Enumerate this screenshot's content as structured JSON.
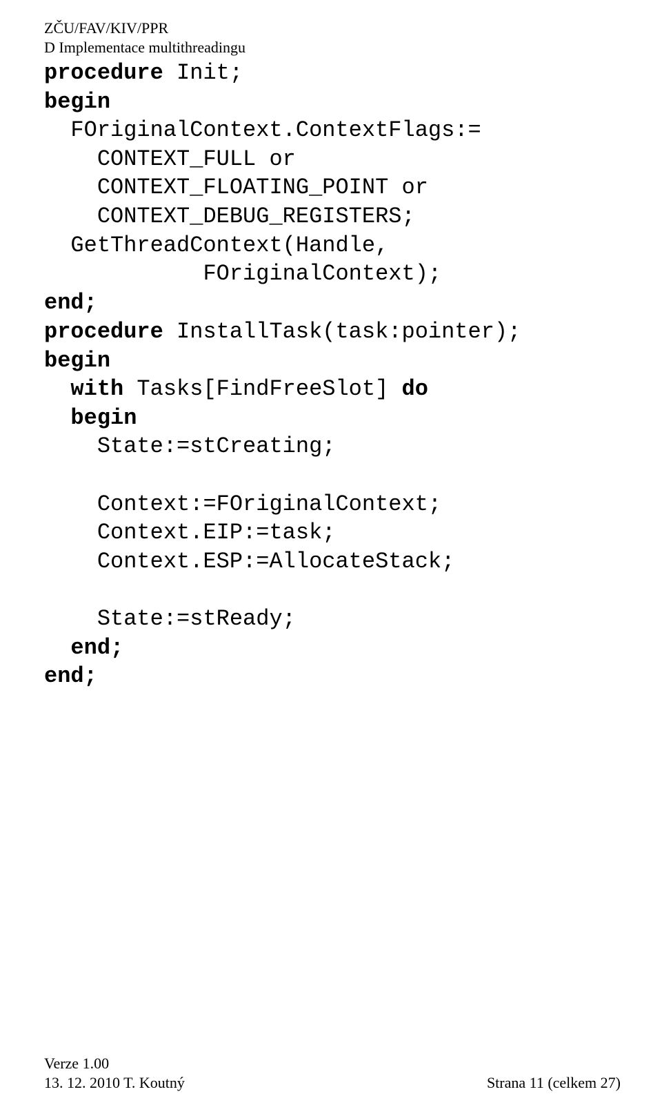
{
  "header": {
    "line1": "ZČU/FAV/KIV/PPR",
    "line2": "D Implementace multithreadingu"
  },
  "code1": {
    "l1a": "procedure",
    "l1b": " Init;",
    "l2": "begin",
    "l3": "  FOriginalContext.ContextFlags:=",
    "l4": "    CONTEXT_FULL or",
    "l5": "    CONTEXT_FLOATING_POINT or",
    "l6": "    CONTEXT_DEBUG_REGISTERS;",
    "l7": "  GetThreadContext(Handle,",
    "l8": "            FOriginalContext);",
    "l9": "end;"
  },
  "code2": {
    "l1a": "procedure",
    "l1b": " InstallTask(task:pointer);",
    "l2": "begin",
    "l3a": "  ",
    "l3b": "with",
    "l3c": " Tasks[FindFreeSlot] ",
    "l3d": "do",
    "l4": "  begin",
    "l5": "    State:=stCreating;",
    "l6": "",
    "l7": "    Context:=FOriginalContext;",
    "l8": "    Context.EIP:=task;",
    "l9": "    Context.ESP:=AllocateStack;",
    "l10": "",
    "l11": "    State:=stReady;",
    "l12": "  end;",
    "l13": "end;"
  },
  "footer": {
    "left1": "Verze 1.00",
    "left2": "13. 12. 2010 T. Koutný",
    "right": "Strana 11 (celkem 27)"
  }
}
